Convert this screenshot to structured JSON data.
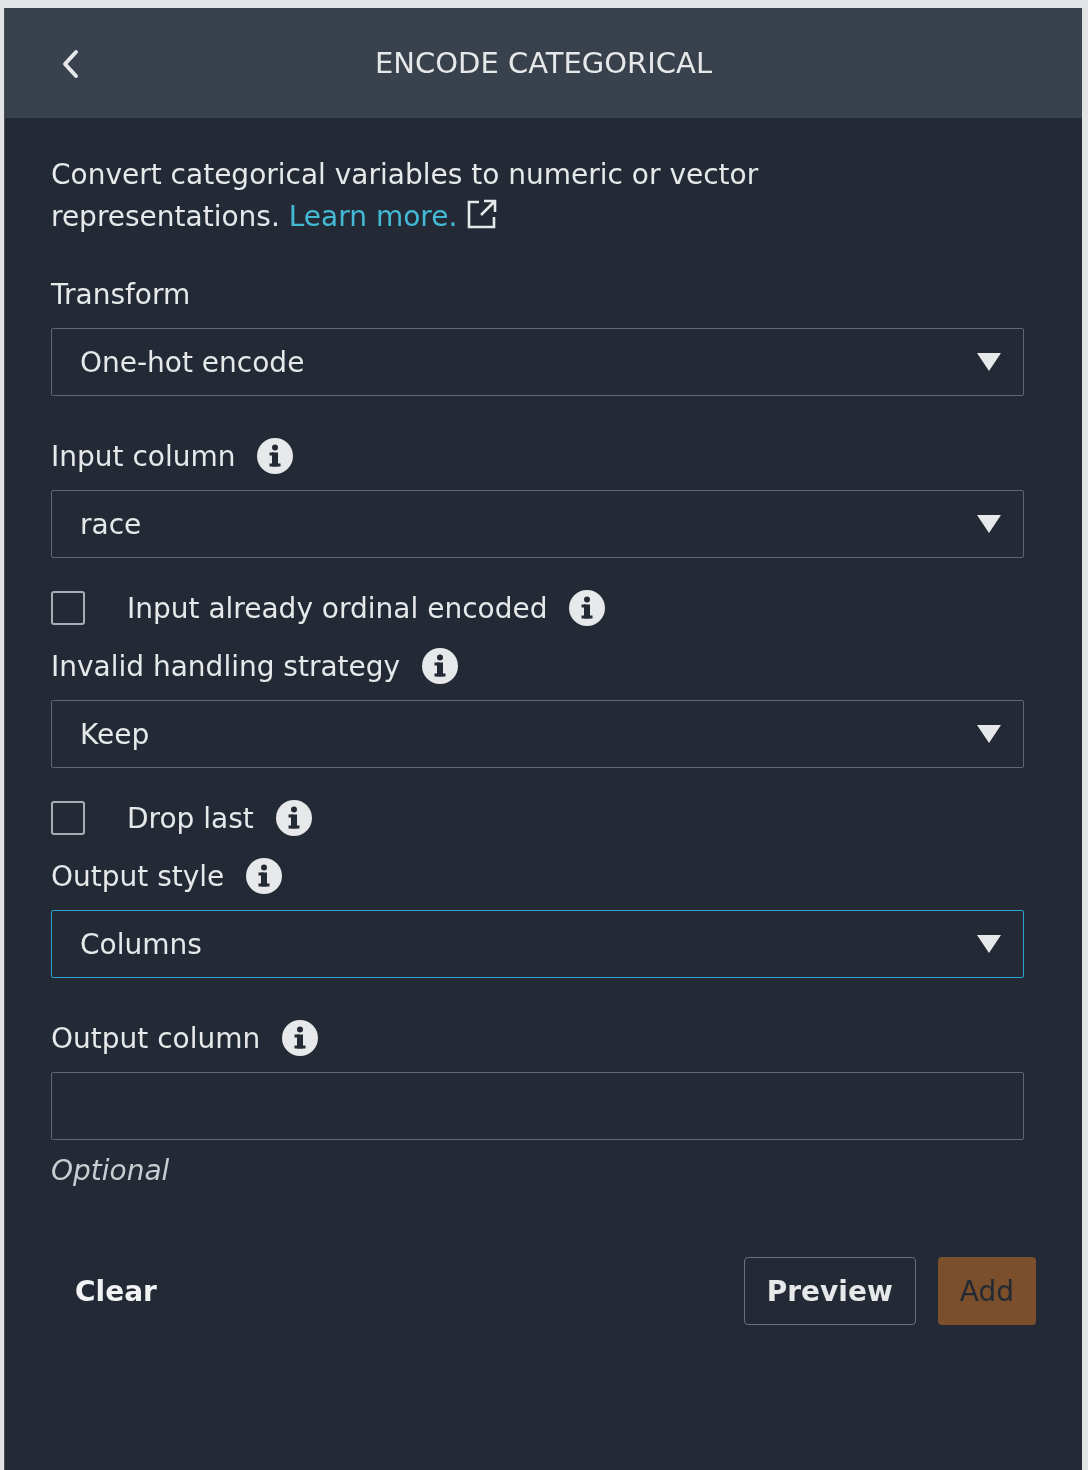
{
  "header": {
    "title": "ENCODE CATEGORICAL"
  },
  "description": {
    "text": "Convert categorical variables to numeric or vector representations.",
    "link": "Learn more."
  },
  "fields": [
    {
      "kind": "select",
      "label": "Transform",
      "value": "One-hot encode",
      "info": false,
      "focused": false
    },
    {
      "kind": "select",
      "label": "Input column",
      "value": "race",
      "info": true,
      "focused": false
    },
    {
      "kind": "checkbox",
      "label": "Input already ordinal encoded",
      "checked": false,
      "info": true
    },
    {
      "kind": "select",
      "label": "Invalid handling strategy",
      "value": "Keep",
      "info": true,
      "focused": false
    },
    {
      "kind": "checkbox",
      "label": "Drop last",
      "checked": false,
      "info": true
    },
    {
      "kind": "select",
      "label": "Output style",
      "value": "Columns",
      "info": true,
      "focused": true
    },
    {
      "kind": "text",
      "label": "Output column",
      "info": true,
      "hint": "Optional"
    }
  ],
  "buttons": {
    "clear": "Clear",
    "preview": "Preview",
    "add": {
      "label": "Add",
      "disabled": true
    }
  }
}
